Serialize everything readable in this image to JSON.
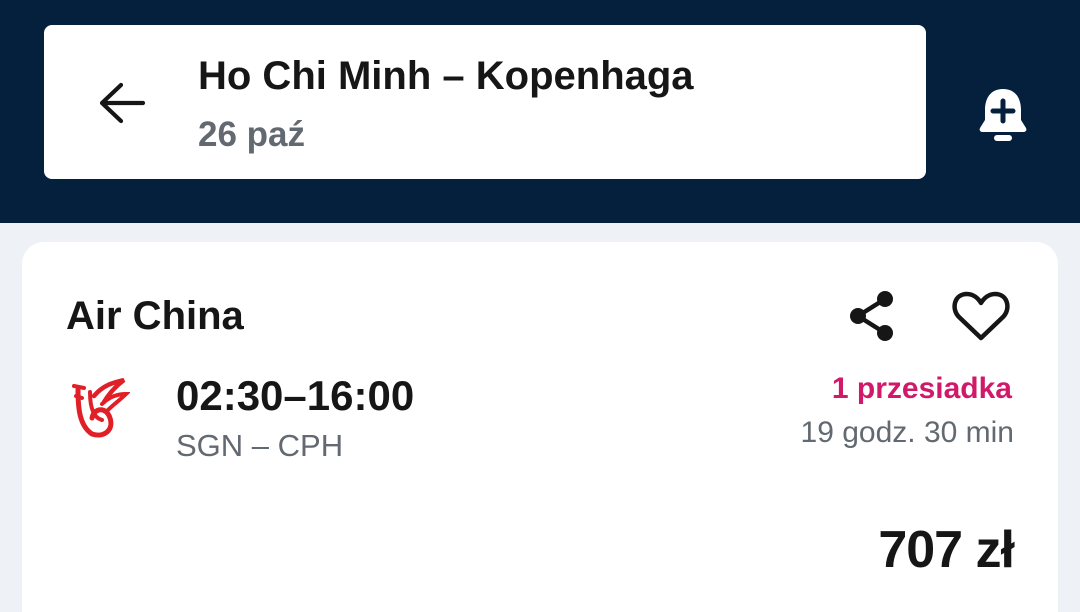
{
  "header": {
    "route_title": "Ho Chi Minh – Kopenhaga",
    "date": "26 paź",
    "back_icon": "arrow-left-icon",
    "alert_icon": "bell-plus-icon",
    "background_color": "#05203c"
  },
  "result": {
    "airline": "Air China",
    "airline_logo": "air-china-phoenix-logo",
    "times": "02:30–16:00",
    "airports": "SGN – CPH",
    "stops": "1 przesiadka",
    "duration": "19 godz. 30 min",
    "price": "707 zł",
    "share_icon": "share-icon",
    "favorite_icon": "heart-icon",
    "stops_color": "#d1196a"
  }
}
